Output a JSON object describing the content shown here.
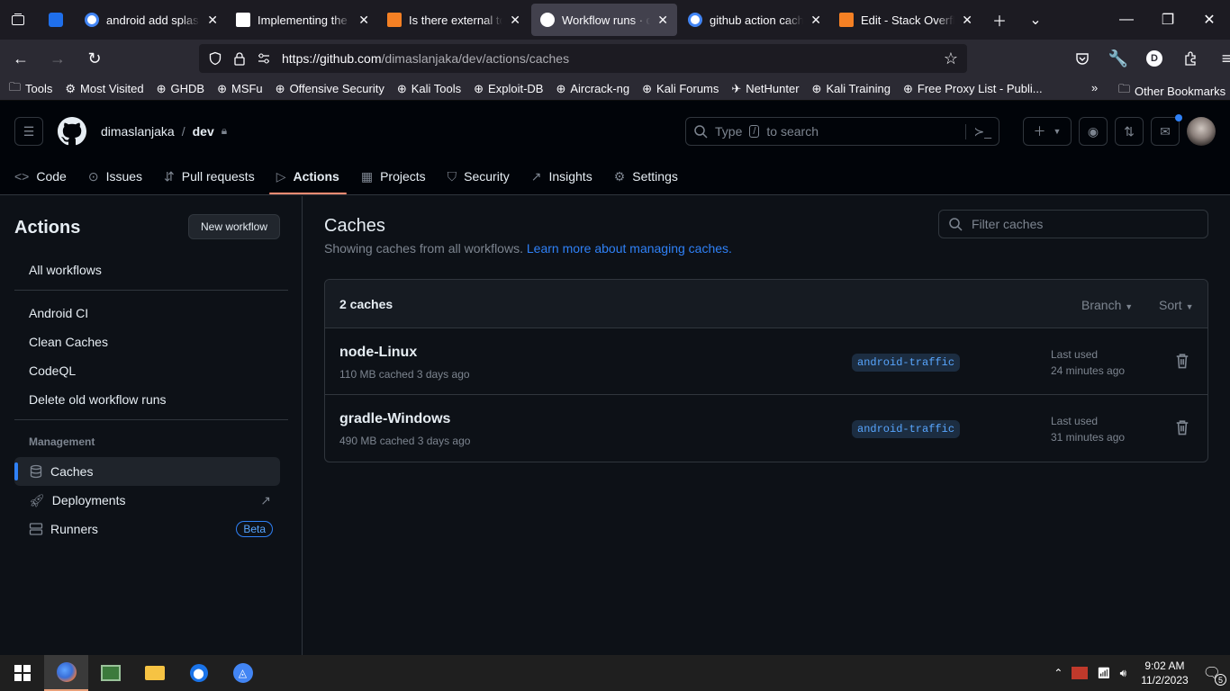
{
  "browser": {
    "tabs": [
      {
        "title": "android add splash a",
        "favicon": "google-icon",
        "color": "#4285f4"
      },
      {
        "title": "Implementing the Pe",
        "favicon": "medium-icon",
        "color": "#ffffff"
      },
      {
        "title": "Is there external tool",
        "favicon": "stackoverflow-icon",
        "color": "#f48024"
      },
      {
        "title": "Workflow runs · dima",
        "favicon": "github-icon",
        "color": "#ffffff",
        "active": true
      },
      {
        "title": "github action cache",
        "favicon": "google-icon",
        "color": "#4285f4"
      },
      {
        "title": "Edit - Stack Overflow",
        "favicon": "stackoverflow-icon",
        "color": "#f48024"
      }
    ],
    "url_host": "https://github.com",
    "url_path": "/dimaslanjaka/dev/actions/caches",
    "bookmarks": [
      "Tools",
      "Most Visited",
      "GHDB",
      "MSFu",
      "Offensive Security",
      "Kali Tools",
      "Exploit-DB",
      "Aircrack-ng",
      "Kali Forums",
      "NetHunter",
      "Kali Training",
      "Free Proxy List - Publi..."
    ],
    "other_bookmarks": "Other Bookmarks",
    "profile_letter": "D"
  },
  "header": {
    "owner": "dimaslanjaka",
    "separator": "/",
    "repo": "dev",
    "search_prefix": "Type",
    "search_key": "/",
    "search_suffix": "to search"
  },
  "repo_tabs": [
    "Code",
    "Issues",
    "Pull requests",
    "Actions",
    "Projects",
    "Security",
    "Insights",
    "Settings"
  ],
  "sidebar": {
    "title": "Actions",
    "new_workflow": "New workflow",
    "all_workflows": "All workflows",
    "workflows": [
      "Android CI",
      "Clean Caches",
      "CodeQL",
      "Delete old workflow runs"
    ],
    "management_label": "Management",
    "caches": "Caches",
    "deployments": "Deployments",
    "runners": "Runners",
    "beta": "Beta"
  },
  "main": {
    "title": "Caches",
    "subtitle": "Showing caches from all workflows.",
    "learn_more": "Learn more about managing caches.",
    "filter_placeholder": "Filter caches",
    "count": "2 caches",
    "branch_label": "Branch",
    "sort_label": "Sort",
    "caches": [
      {
        "name": "node-Linux",
        "meta": "110 MB cached 3 days ago",
        "branch": "android-traffic",
        "last_used_label": "Last used",
        "last_used": "24 minutes ago"
      },
      {
        "name": "gradle-Windows",
        "meta": "490 MB cached 3 days ago",
        "branch": "android-traffic",
        "last_used_label": "Last used",
        "last_used": "31 minutes ago"
      }
    ]
  },
  "taskbar": {
    "time": "9:02 AM",
    "date": "11/2/2023",
    "notif_count": "5"
  },
  "colors": {
    "accent": "#2f81f7",
    "tab_underline": "#fd8c73"
  }
}
